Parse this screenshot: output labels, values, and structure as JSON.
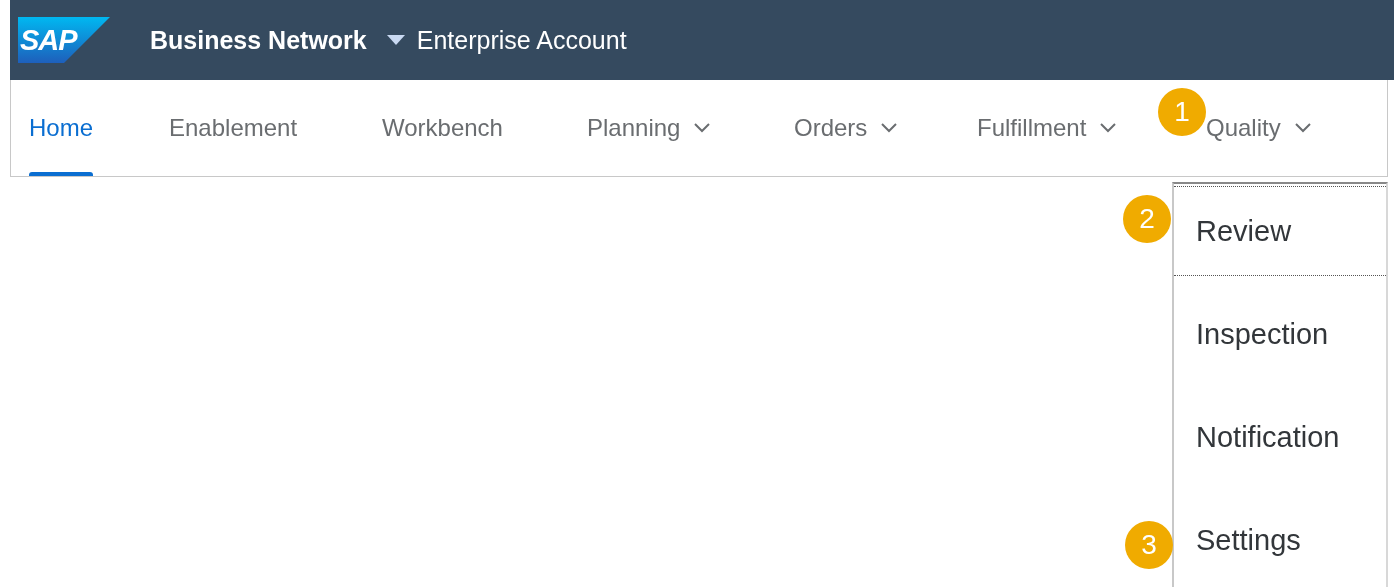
{
  "header": {
    "logo": "SAP",
    "product": "Business Network",
    "account": "Enterprise Account"
  },
  "tabs": [
    {
      "label": "Home",
      "selected": true,
      "has_menu": false
    },
    {
      "label": "Enablement",
      "selected": false,
      "has_menu": false
    },
    {
      "label": "Workbench",
      "selected": false,
      "has_menu": false
    },
    {
      "label": "Planning",
      "selected": false,
      "has_menu": true
    },
    {
      "label": "Orders",
      "selected": false,
      "has_menu": true
    },
    {
      "label": "Fulfillment",
      "selected": false,
      "has_menu": true
    },
    {
      "label": "Quality",
      "selected": false,
      "has_menu": true
    }
  ],
  "menu": {
    "items": [
      {
        "label": "Review",
        "focused": true
      },
      {
        "label": "Inspection",
        "focused": false
      },
      {
        "label": "Notification",
        "focused": false
      },
      {
        "label": "Settings",
        "focused": false
      }
    ]
  },
  "callouts": [
    "1",
    "2",
    "3"
  ]
}
